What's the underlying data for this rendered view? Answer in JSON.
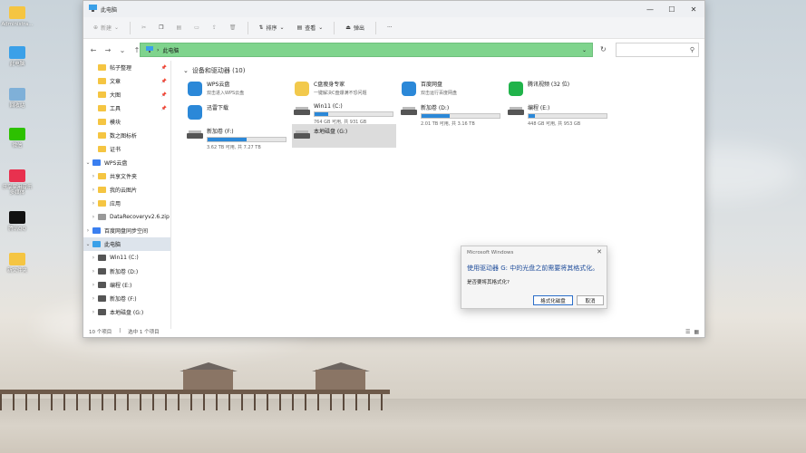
{
  "desktop": {
    "icons": [
      {
        "label": "Administra...",
        "icon": "folder-icon",
        "color": "#f5c542"
      },
      {
        "label": "此电脑",
        "icon": "computer-icon",
        "color": "#3aa0e8"
      },
      {
        "label": "回收站",
        "icon": "recycle-bin-icon",
        "color": "#7fb0d8"
      },
      {
        "label": "微信",
        "icon": "wechat-icon",
        "color": "#2dc100"
      },
      {
        "label": "乐享家用音乐多媒体",
        "icon": "app-icon",
        "color": "#e8314f"
      },
      {
        "label": "腾讯QQ",
        "icon": "qq-icon",
        "color": "#111111"
      },
      {
        "label": "新文件夹",
        "icon": "folder-icon",
        "color": "#f5c542"
      }
    ]
  },
  "window": {
    "title": "此电脑",
    "toolbar": {
      "new": "新建",
      "sort": "排序",
      "view": "查看",
      "eject": "弹出",
      "more": "···"
    },
    "address": "此电脑",
    "accent": "#7fd48d"
  },
  "sidebar": {
    "items": [
      {
        "label": "帖子整理",
        "color": "#f5c542",
        "pinned": true,
        "indent": 1
      },
      {
        "label": "文章",
        "color": "#f5c542",
        "pinned": true,
        "indent": 1
      },
      {
        "label": "大图",
        "color": "#f5c542",
        "pinned": true,
        "indent": 1
      },
      {
        "label": "工具",
        "color": "#f5c542",
        "pinned": true,
        "indent": 1
      },
      {
        "label": "模块",
        "color": "#f5c542",
        "pinned": false,
        "indent": 1
      },
      {
        "label": "数之图标析",
        "color": "#f5c542",
        "pinned": false,
        "indent": 1
      },
      {
        "label": "证书",
        "color": "#f5c542",
        "pinned": false,
        "indent": 1
      },
      {
        "label": "WPS云盘",
        "color": "#3a7ff0",
        "pinned": false,
        "indent": 0,
        "arrow": "⌄"
      },
      {
        "label": "共享文件夹",
        "color": "#f5c542",
        "pinned": false,
        "indent": 1,
        "arrow": "›"
      },
      {
        "label": "我的云图片",
        "color": "#f5c542",
        "pinned": false,
        "indent": 1,
        "arrow": "›"
      },
      {
        "label": "应用",
        "color": "#f5c542",
        "pinned": false,
        "indent": 1,
        "arrow": "›"
      },
      {
        "label": "DataRecoveryv2.6.zip",
        "color": "#999999",
        "pinned": false,
        "indent": 1,
        "arrow": "›"
      },
      {
        "label": "百度网盘同步空间",
        "color": "#3a7ff0",
        "pinned": false,
        "indent": 0,
        "arrow": "›"
      },
      {
        "label": "此电脑",
        "color": "#3aa0e8",
        "pinned": false,
        "indent": 0,
        "arrow": "⌄",
        "selected": true
      },
      {
        "label": "Win11 (C:)",
        "color": "#555555",
        "pinned": false,
        "indent": 1,
        "arrow": "›"
      },
      {
        "label": "新加卷 (D:)",
        "color": "#555555",
        "pinned": false,
        "indent": 1,
        "arrow": "›"
      },
      {
        "label": "编程 (E:)",
        "color": "#555555",
        "pinned": false,
        "indent": 1,
        "arrow": "›"
      },
      {
        "label": "新加卷 (F:)",
        "color": "#555555",
        "pinned": false,
        "indent": 1,
        "arrow": "›"
      },
      {
        "label": "本地磁盘 (G:)",
        "color": "#555555",
        "pinned": false,
        "indent": 1,
        "arrow": "›"
      }
    ]
  },
  "content": {
    "section_title": "设备和驱动器 (10)",
    "items": [
      {
        "name": "WPS云盘",
        "sub": "双击进入WPS云盘",
        "icon": "cloud-icon",
        "color": "#2b88d8",
        "col": 0,
        "row": 0
      },
      {
        "name": "C盘瘦身专家",
        "sub": "一键解决C盘爆满不恐问题",
        "icon": "windows-logo-icon",
        "color": "#f2c94c",
        "col": 1,
        "row": 0
      },
      {
        "name": "百度网盘",
        "sub": "双击运行百度网盘",
        "icon": "baidu-cloud-icon",
        "color": "#2b88d8",
        "col": 2,
        "row": 0
      },
      {
        "name": "腾讯视频 (32 位)",
        "sub": "",
        "icon": "video-icon",
        "color": "#20b34a",
        "col": 3,
        "row": 0
      },
      {
        "name": "迅雷下载",
        "sub": "",
        "icon": "thunder-icon",
        "color": "#2b88d8",
        "col": 0,
        "row": 1
      },
      {
        "name": "Win11 (C:)",
        "sub": "764 GB 可用, 共 931 GB",
        "icon": "windows-drive-icon",
        "fill": 0.18,
        "col": 1,
        "row": 1
      },
      {
        "name": "新加卷 (D:)",
        "sub": "2.01 TB 可用, 共 3.16 TB",
        "icon": "drive-icon",
        "fill": 0.36,
        "col": 2,
        "row": 1
      },
      {
        "name": "编程 (E:)",
        "sub": "448 GB 可用, 共 953 GB",
        "icon": "drive-icon",
        "fill": 0.08,
        "col": 3,
        "row": 1
      },
      {
        "name": "新加卷 (F:)",
        "sub": "3.62 TB 可用, 共 7.27 TB",
        "icon": "drive-icon",
        "fill": 0.5,
        "col": 0,
        "row": 2
      },
      {
        "name": "本地磁盘 (G:)",
        "sub": "",
        "icon": "drive-icon",
        "col": 1,
        "row": 2,
        "selected": true
      }
    ]
  },
  "statusbar": {
    "count": "10 个项目",
    "selected": "选中 1 个项目"
  },
  "dialog": {
    "title": "Microsoft Windows",
    "message": "使用驱动器 G: 中的光盘之前需要将其格式化。",
    "question": "是否要将其格式化?",
    "format_label": "格式化磁盘",
    "cancel_label": "取消"
  }
}
